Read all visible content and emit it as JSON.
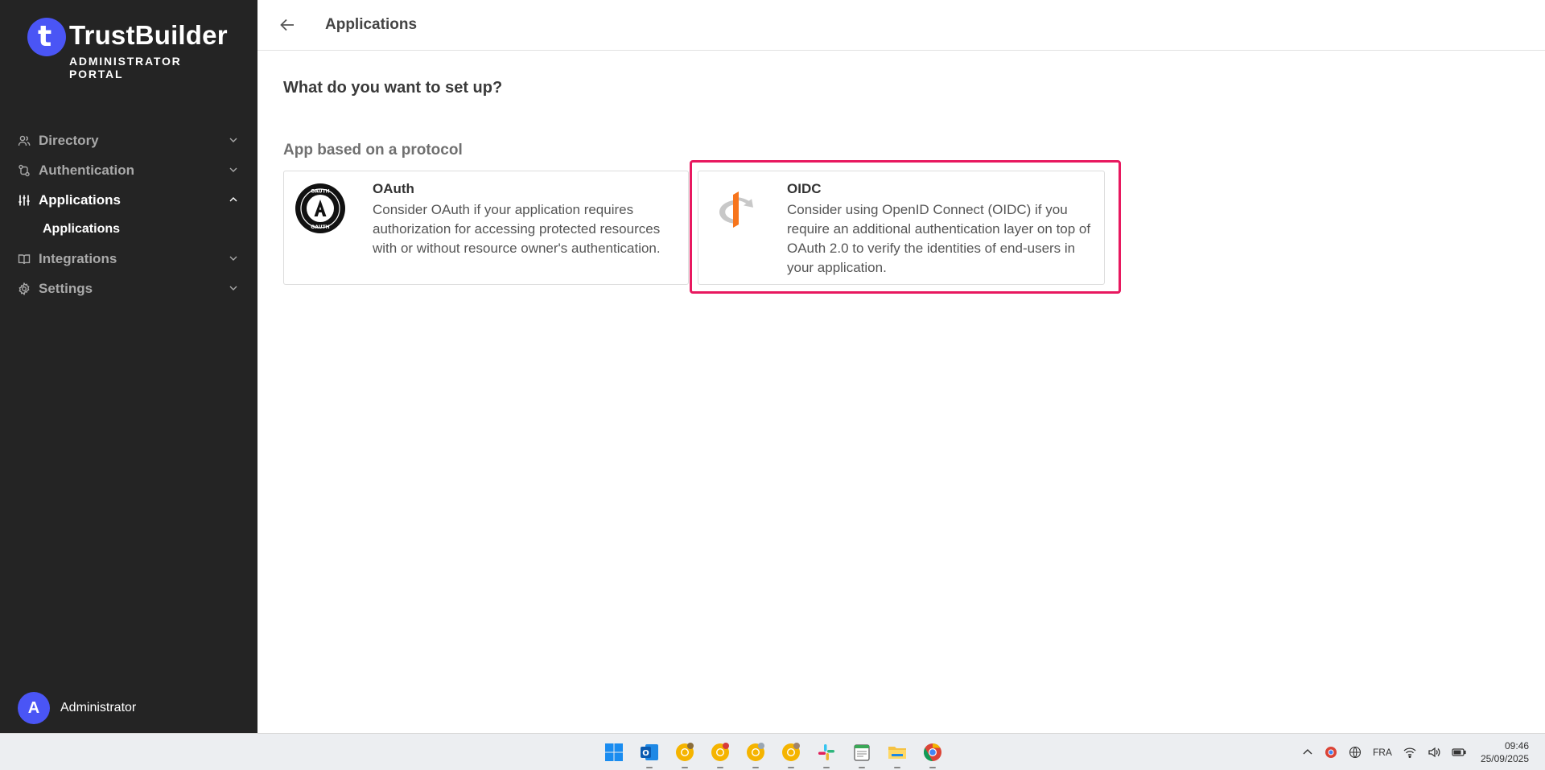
{
  "brand": {
    "name": "TrustBuilder",
    "subtitle": "ADMINISTRATOR PORTAL",
    "accent": "#4a55f5"
  },
  "sidebar": {
    "items": [
      {
        "label": "Directory",
        "icon": "users-icon",
        "expanded": false
      },
      {
        "label": "Authentication",
        "icon": "auth-flow-icon",
        "expanded": false
      },
      {
        "label": "Applications",
        "icon": "sliders-icon",
        "expanded": true,
        "children": [
          {
            "label": "Applications"
          }
        ]
      },
      {
        "label": "Integrations",
        "icon": "book-icon",
        "expanded": false
      },
      {
        "label": "Settings",
        "icon": "gear-icon",
        "expanded": false
      }
    ]
  },
  "user": {
    "initial": "A",
    "name": "Administrator"
  },
  "header": {
    "title": "Applications"
  },
  "main": {
    "question": "What do you want to set up?",
    "section": "App based on a protocol",
    "cards": [
      {
        "title": "OAuth",
        "description": "Consider OAuth if your application requires authorization for accessing protected resources with or without resource owner's authentication.",
        "icon": "oauth-logo-icon"
      },
      {
        "title": "OIDC",
        "description": "Consider using OpenID Connect (OIDC) if you require an additional authentication layer on top of OAuth 2.0 to verify the identities of end-users in your application.",
        "icon": "openid-logo-icon",
        "highlighted": true
      }
    ],
    "highlight_color": "#e8185f"
  },
  "taskbar": {
    "apps": [
      "windows-start-icon",
      "outlook-icon",
      "chrome-icon",
      "chrome-icon",
      "chrome-icon",
      "chrome-icon",
      "slack-icon",
      "notepad-icon",
      "file-explorer-icon",
      "chrome-icon"
    ],
    "language": "FRA",
    "time": "09:46",
    "date": "25/09/2025"
  }
}
